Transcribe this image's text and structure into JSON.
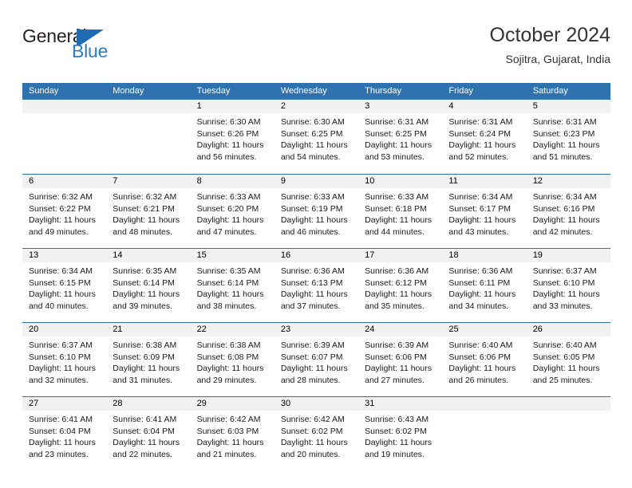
{
  "brand": {
    "word1": "General",
    "word2": "Blue",
    "accent_color": "#2b7cc1"
  },
  "header": {
    "title": "October 2024",
    "subtitle": "Sojitra, Gujarat, India"
  },
  "calendar": {
    "header_color": "#3071b0",
    "date_band_color": "#f1f1f1",
    "day_names": [
      "Sunday",
      "Monday",
      "Tuesday",
      "Wednesday",
      "Thursday",
      "Friday",
      "Saturday"
    ],
    "weeks": [
      [
        {
          "date": "",
          "empty": true
        },
        {
          "date": "",
          "empty": true
        },
        {
          "date": "1",
          "sunrise": "Sunrise: 6:30 AM",
          "sunset": "Sunset: 6:26 PM",
          "daylight1": "Daylight: 11 hours",
          "daylight2": "and 56 minutes."
        },
        {
          "date": "2",
          "sunrise": "Sunrise: 6:30 AM",
          "sunset": "Sunset: 6:25 PM",
          "daylight1": "Daylight: 11 hours",
          "daylight2": "and 54 minutes."
        },
        {
          "date": "3",
          "sunrise": "Sunrise: 6:31 AM",
          "sunset": "Sunset: 6:25 PM",
          "daylight1": "Daylight: 11 hours",
          "daylight2": "and 53 minutes."
        },
        {
          "date": "4",
          "sunrise": "Sunrise: 6:31 AM",
          "sunset": "Sunset: 6:24 PM",
          "daylight1": "Daylight: 11 hours",
          "daylight2": "and 52 minutes."
        },
        {
          "date": "5",
          "sunrise": "Sunrise: 6:31 AM",
          "sunset": "Sunset: 6:23 PM",
          "daylight1": "Daylight: 11 hours",
          "daylight2": "and 51 minutes."
        }
      ],
      [
        {
          "date": "6",
          "sunrise": "Sunrise: 6:32 AM",
          "sunset": "Sunset: 6:22 PM",
          "daylight1": "Daylight: 11 hours",
          "daylight2": "and 49 minutes."
        },
        {
          "date": "7",
          "sunrise": "Sunrise: 6:32 AM",
          "sunset": "Sunset: 6:21 PM",
          "daylight1": "Daylight: 11 hours",
          "daylight2": "and 48 minutes."
        },
        {
          "date": "8",
          "sunrise": "Sunrise: 6:33 AM",
          "sunset": "Sunset: 6:20 PM",
          "daylight1": "Daylight: 11 hours",
          "daylight2": "and 47 minutes."
        },
        {
          "date": "9",
          "sunrise": "Sunrise: 6:33 AM",
          "sunset": "Sunset: 6:19 PM",
          "daylight1": "Daylight: 11 hours",
          "daylight2": "and 46 minutes."
        },
        {
          "date": "10",
          "sunrise": "Sunrise: 6:33 AM",
          "sunset": "Sunset: 6:18 PM",
          "daylight1": "Daylight: 11 hours",
          "daylight2": "and 44 minutes."
        },
        {
          "date": "11",
          "sunrise": "Sunrise: 6:34 AM",
          "sunset": "Sunset: 6:17 PM",
          "daylight1": "Daylight: 11 hours",
          "daylight2": "and 43 minutes."
        },
        {
          "date": "12",
          "sunrise": "Sunrise: 6:34 AM",
          "sunset": "Sunset: 6:16 PM",
          "daylight1": "Daylight: 11 hours",
          "daylight2": "and 42 minutes."
        }
      ],
      [
        {
          "date": "13",
          "sunrise": "Sunrise: 6:34 AM",
          "sunset": "Sunset: 6:15 PM",
          "daylight1": "Daylight: 11 hours",
          "daylight2": "and 40 minutes."
        },
        {
          "date": "14",
          "sunrise": "Sunrise: 6:35 AM",
          "sunset": "Sunset: 6:14 PM",
          "daylight1": "Daylight: 11 hours",
          "daylight2": "and 39 minutes."
        },
        {
          "date": "15",
          "sunrise": "Sunrise: 6:35 AM",
          "sunset": "Sunset: 6:14 PM",
          "daylight1": "Daylight: 11 hours",
          "daylight2": "and 38 minutes."
        },
        {
          "date": "16",
          "sunrise": "Sunrise: 6:36 AM",
          "sunset": "Sunset: 6:13 PM",
          "daylight1": "Daylight: 11 hours",
          "daylight2": "and 37 minutes."
        },
        {
          "date": "17",
          "sunrise": "Sunrise: 6:36 AM",
          "sunset": "Sunset: 6:12 PM",
          "daylight1": "Daylight: 11 hours",
          "daylight2": "and 35 minutes."
        },
        {
          "date": "18",
          "sunrise": "Sunrise: 6:36 AM",
          "sunset": "Sunset: 6:11 PM",
          "daylight1": "Daylight: 11 hours",
          "daylight2": "and 34 minutes."
        },
        {
          "date": "19",
          "sunrise": "Sunrise: 6:37 AM",
          "sunset": "Sunset: 6:10 PM",
          "daylight1": "Daylight: 11 hours",
          "daylight2": "and 33 minutes."
        }
      ],
      [
        {
          "date": "20",
          "sunrise": "Sunrise: 6:37 AM",
          "sunset": "Sunset: 6:10 PM",
          "daylight1": "Daylight: 11 hours",
          "daylight2": "and 32 minutes."
        },
        {
          "date": "21",
          "sunrise": "Sunrise: 6:38 AM",
          "sunset": "Sunset: 6:09 PM",
          "daylight1": "Daylight: 11 hours",
          "daylight2": "and 31 minutes."
        },
        {
          "date": "22",
          "sunrise": "Sunrise: 6:38 AM",
          "sunset": "Sunset: 6:08 PM",
          "daylight1": "Daylight: 11 hours",
          "daylight2": "and 29 minutes."
        },
        {
          "date": "23",
          "sunrise": "Sunrise: 6:39 AM",
          "sunset": "Sunset: 6:07 PM",
          "daylight1": "Daylight: 11 hours",
          "daylight2": "and 28 minutes."
        },
        {
          "date": "24",
          "sunrise": "Sunrise: 6:39 AM",
          "sunset": "Sunset: 6:06 PM",
          "daylight1": "Daylight: 11 hours",
          "daylight2": "and 27 minutes."
        },
        {
          "date": "25",
          "sunrise": "Sunrise: 6:40 AM",
          "sunset": "Sunset: 6:06 PM",
          "daylight1": "Daylight: 11 hours",
          "daylight2": "and 26 minutes."
        },
        {
          "date": "26",
          "sunrise": "Sunrise: 6:40 AM",
          "sunset": "Sunset: 6:05 PM",
          "daylight1": "Daylight: 11 hours",
          "daylight2": "and 25 minutes."
        }
      ],
      [
        {
          "date": "27",
          "sunrise": "Sunrise: 6:41 AM",
          "sunset": "Sunset: 6:04 PM",
          "daylight1": "Daylight: 11 hours",
          "daylight2": "and 23 minutes."
        },
        {
          "date": "28",
          "sunrise": "Sunrise: 6:41 AM",
          "sunset": "Sunset: 6:04 PM",
          "daylight1": "Daylight: 11 hours",
          "daylight2": "and 22 minutes."
        },
        {
          "date": "29",
          "sunrise": "Sunrise: 6:42 AM",
          "sunset": "Sunset: 6:03 PM",
          "daylight1": "Daylight: 11 hours",
          "daylight2": "and 21 minutes."
        },
        {
          "date": "30",
          "sunrise": "Sunrise: 6:42 AM",
          "sunset": "Sunset: 6:02 PM",
          "daylight1": "Daylight: 11 hours",
          "daylight2": "and 20 minutes."
        },
        {
          "date": "31",
          "sunrise": "Sunrise: 6:43 AM",
          "sunset": "Sunset: 6:02 PM",
          "daylight1": "Daylight: 11 hours",
          "daylight2": "and 19 minutes."
        },
        {
          "date": "",
          "empty": true
        },
        {
          "date": "",
          "empty": true
        }
      ]
    ]
  }
}
